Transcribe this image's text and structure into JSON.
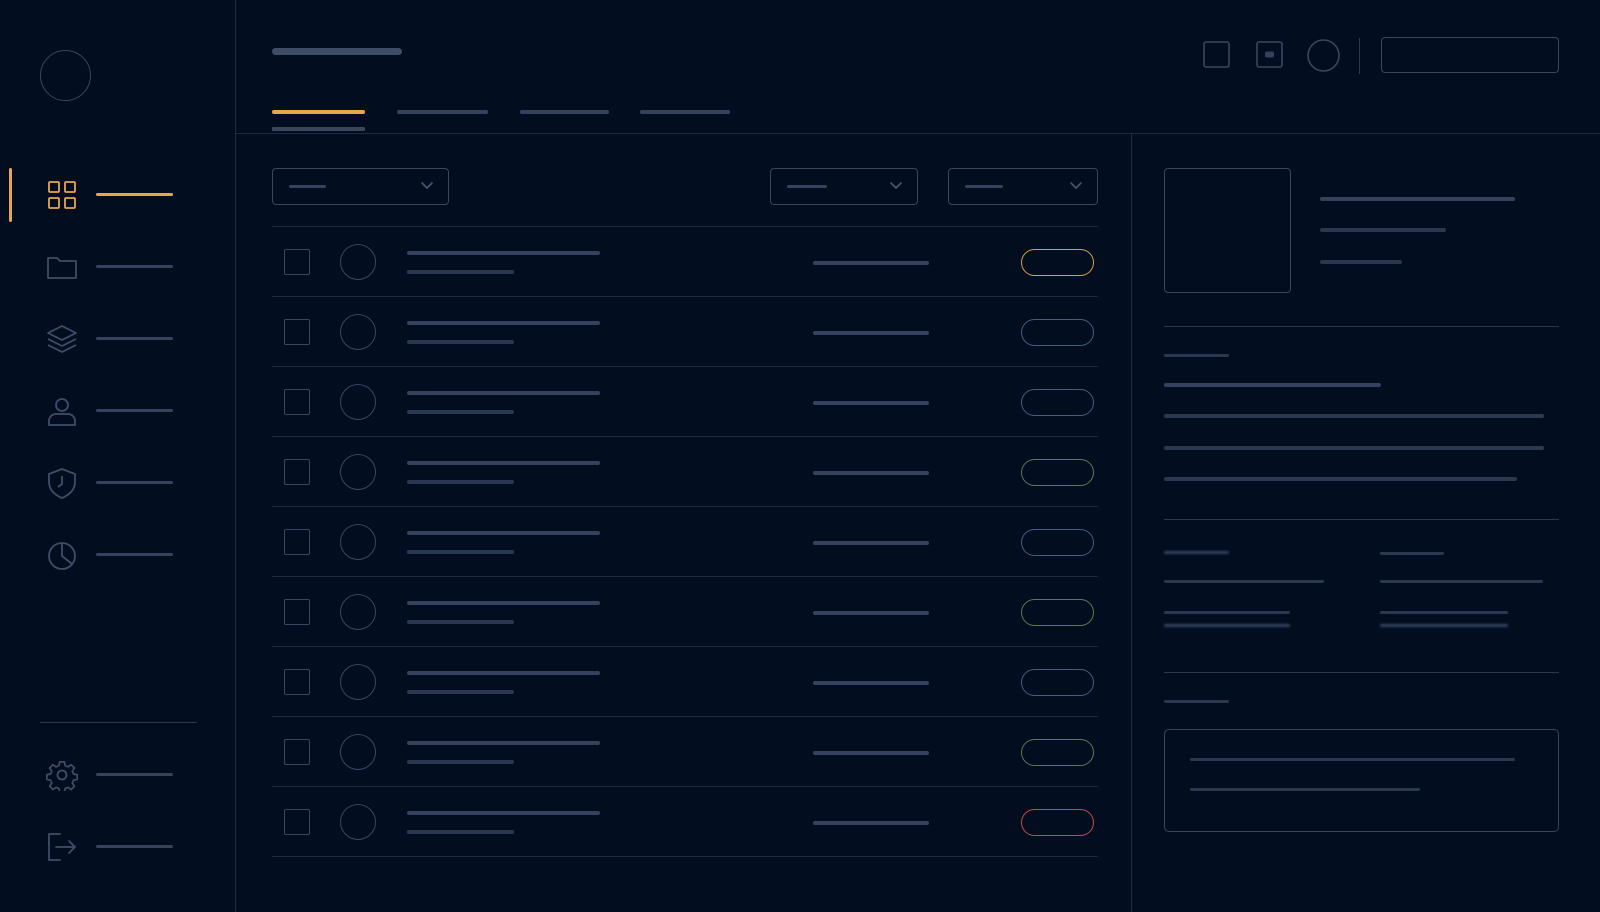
{
  "colors": {
    "background": "#020d20",
    "accent": "#e8a748",
    "status_amber": "#d9a23e",
    "status_blue": "#4a5b82",
    "status_green": "#5f7a52",
    "status_red": "#c84a46",
    "outline": "#3a4660"
  },
  "sidebar": {
    "logo_icon": "logo-circle",
    "items": [
      {
        "icon": "grid-icon",
        "active": true
      },
      {
        "icon": "folder-icon",
        "active": false
      },
      {
        "icon": "layers-icon",
        "active": false
      },
      {
        "icon": "user-icon",
        "active": false
      },
      {
        "icon": "shield-icon",
        "active": false
      },
      {
        "icon": "pie-chart-icon",
        "active": false
      }
    ],
    "footer_items": [
      {
        "icon": "gear-icon"
      },
      {
        "icon": "logout-icon"
      }
    ]
  },
  "header": {
    "tabs": [
      {
        "active": true
      },
      {
        "active": false
      },
      {
        "active": false
      },
      {
        "active": false
      }
    ],
    "icons": [
      "square-icon",
      "stop-square-icon",
      "circle-icon"
    ],
    "search_value": ""
  },
  "filters": {
    "icons": [
      "chevron-down-icon",
      "chevron-down-icon",
      "chevron-down-icon"
    ]
  },
  "table": {
    "rows": [
      {
        "status": "amber"
      },
      {
        "status": "blue"
      },
      {
        "status": "blue"
      },
      {
        "status": "green"
      },
      {
        "status": "blue"
      },
      {
        "status": "green"
      },
      {
        "status": "blue"
      },
      {
        "status": "green"
      },
      {
        "status": "red"
      }
    ]
  },
  "detail_panel": {
    "icons": [
      "thumbnail-placeholder"
    ]
  }
}
